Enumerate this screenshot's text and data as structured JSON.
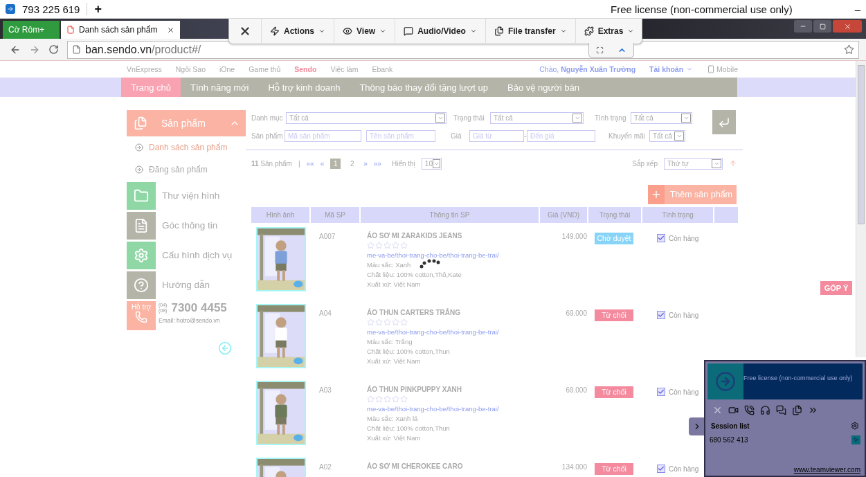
{
  "teamviewer_bar": {
    "partner_id": "793 225 619",
    "add": "+",
    "license": "Free license (non-commercial use only)",
    "minimize": "–"
  },
  "browser_tabs": [
    {
      "label": "Cờ Rôm+",
      "selected": false
    },
    {
      "label": "Danh sách sản phẩm",
      "selected": true
    }
  ],
  "teamviewer_toolbar": {
    "items": [
      "Actions",
      "View",
      "Audio/Video",
      "File transfer",
      "Extras"
    ]
  },
  "address_bar": {
    "host": "ban.sendo.vn",
    "path": "/product#/"
  },
  "top_links": [
    {
      "label": "VnExpress",
      "selected": false
    },
    {
      "label": "Ngôi Sao",
      "selected": false
    },
    {
      "label": "iOne",
      "selected": false
    },
    {
      "label": "Game thủ",
      "selected": false
    },
    {
      "label": "Sendo",
      "selected": true
    },
    {
      "label": "Việc làm",
      "selected": false
    },
    {
      "label": "Ebank",
      "selected": false
    }
  ],
  "user": {
    "greeting": "Chào,",
    "name": "Nguyễn Xuân Trường",
    "account": "Tài khoản",
    "mobile": "Mobile"
  },
  "nav": [
    {
      "label": "Trang chủ",
      "selected": true
    },
    {
      "label": "Tính năng mới",
      "selected": false
    },
    {
      "label": "Hỗ trợ kinh doanh",
      "selected": false
    },
    {
      "label": "Thông báo thay đổi tặng lượt up",
      "selected": false
    },
    {
      "label": "Bảo vệ người bán",
      "selected": false
    }
  ],
  "sidebar": {
    "section": {
      "label": "Sản phẩm",
      "expanded": true,
      "children": [
        {
          "label": "Danh sách sản phẩm",
          "selected": true
        },
        {
          "label": "Đăng sản phẩm",
          "selected": false
        }
      ]
    },
    "items": [
      {
        "label": "Thư viện hình",
        "color": "#8fd8a6"
      },
      {
        "label": "Góc thông tin",
        "color": "#b4b4a8"
      },
      {
        "label": "Cấu hình dịch vụ",
        "color": "#8fd8a6"
      },
      {
        "label": "Hướng dẫn",
        "color": "#b4b4a8"
      }
    ],
    "support": {
      "label": "Hỗ trợ",
      "area_codes": [
        "(04)",
        "(08)"
      ],
      "phone": "7300 4455",
      "email": "Email: hotro@sendo.vn"
    }
  },
  "filters": {
    "category": {
      "label": "Danh mục",
      "value": "Tất cả"
    },
    "status": {
      "label": "Trạng thái",
      "value": "Tất cả"
    },
    "condition": {
      "label": "Tình trạng",
      "value": "Tất cả"
    },
    "product": {
      "label": "Sản phẩm",
      "code_placeholder": "Mã sản phẩm",
      "name_placeholder": "Tên sản phẩm"
    },
    "price": {
      "label": "Giá",
      "from_placeholder": "Giá từ",
      "separator": "-",
      "to_placeholder": "Đến giá"
    },
    "promotion": {
      "label": "Khuyến mãi",
      "value": "Tất cả"
    }
  },
  "pagination": {
    "count": "11",
    "count_label": "Sản phẩm",
    "separator": "|",
    "prev": [
      "««",
      "«"
    ],
    "pages": [
      {
        "label": "1",
        "selected": true
      },
      {
        "label": "2",
        "selected": false
      }
    ],
    "next": [
      "»",
      "»»"
    ],
    "page_size_label": "Hiển thị",
    "page_size": "10"
  },
  "sort": {
    "label": "Sắp xếp",
    "value": "Thứ tự"
  },
  "add_button": "Thêm sản phẩm",
  "table": {
    "columns": [
      "Hình ảnh",
      "Mã SP",
      "Thông tin SP",
      "Giá (VND)",
      "Trạng thái",
      "Tình trạng"
    ],
    "rows": [
      {
        "code": "A007",
        "title": "ÁO SƠ MI ZARAKIDS JEANS",
        "stars": 0,
        "category": "me-va-be/thoi-trang-cho-be/thoi-trang-be-trai/",
        "specs": [
          "Màu sắc: Xanh",
          "Chất liệu: 100% cotton,Thô,Kate",
          "Xuất xứ: Việt Nam"
        ],
        "price": "149.000",
        "status": {
          "label": "Chờ duyệt",
          "kind": "pending"
        },
        "stock": {
          "label": "Còn hàng",
          "checked": true
        }
      },
      {
        "code": "A04",
        "title": "ÁO THUN CARTERS TRẮNG",
        "stars": 0,
        "category": "me-va-be/thoi-trang-cho-be/thoi-trang-be-trai/",
        "specs": [
          "Màu sắc: Trắng",
          "Chất liệu: 100% cotton,Thun",
          "Xuất xứ: Việt Nam"
        ],
        "price": "69.000",
        "status": {
          "label": "Từ chối",
          "kind": "rejected"
        },
        "stock": {
          "label": "Còn hàng",
          "checked": true
        }
      },
      {
        "code": "A03",
        "title": "ÁO THUN PINKPUPPY XANH",
        "stars": 0,
        "category": "me-va-be/thoi-trang-cho-be/thoi-trang-be-trai/",
        "specs": [
          "Màu sắc: Xanh lá",
          "Chất liệu: 100% cotton,Thun",
          "Xuất xứ: Việt Nam"
        ],
        "price": "69.000",
        "status": {
          "label": "Từ chối",
          "kind": "rejected"
        },
        "stock": {
          "label": "Còn hàng",
          "checked": true
        }
      },
      {
        "code": "A02",
        "title": "ÁO SƠ MI CHEROKEE CARO",
        "price": "134.000",
        "status": {
          "label": "Từ chối",
          "kind": "rejected"
        },
        "stock": {
          "label": "Còn hàng",
          "checked": true
        }
      }
    ]
  },
  "feedback": "GÓP Ý",
  "teamviewer_panel": {
    "license": "Free license (non-commercial use only)",
    "session_title": "Session list",
    "sessions": [
      "680 562 413"
    ],
    "link": "www.teamviewer.com"
  }
}
